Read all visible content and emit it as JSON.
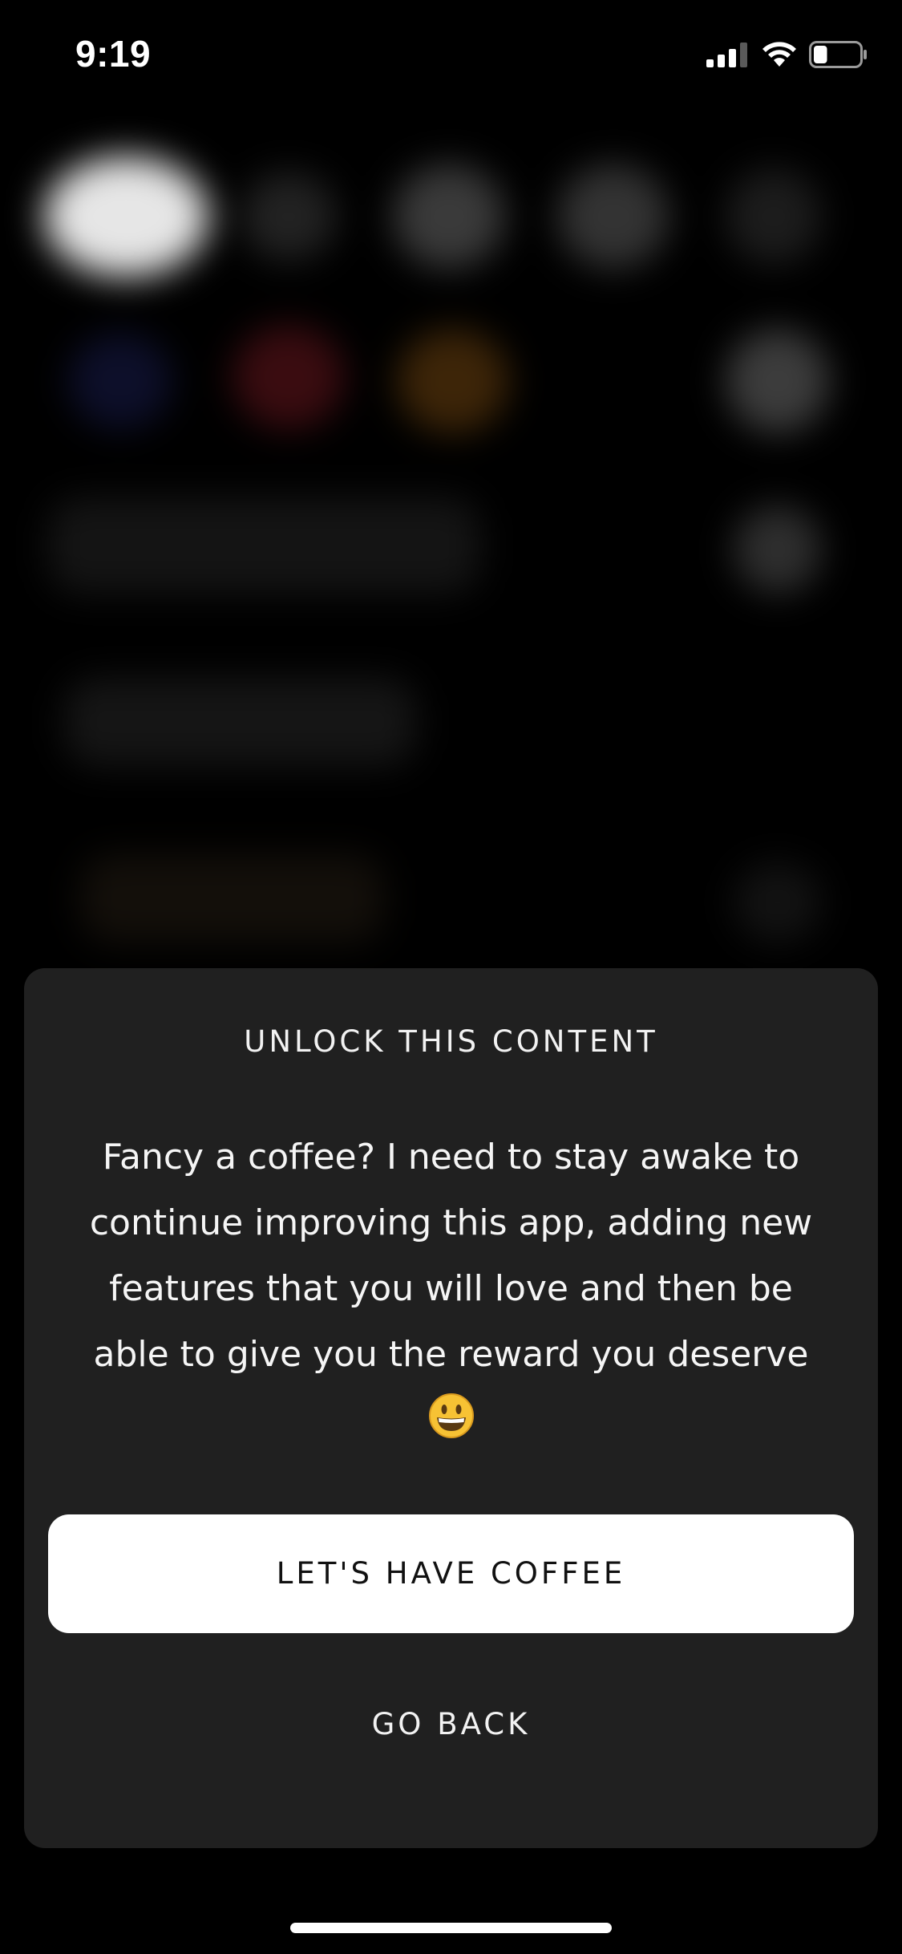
{
  "status_bar": {
    "time": "9:19",
    "icons": [
      "cellular-signal-icon",
      "wifi-icon",
      "battery-icon"
    ],
    "battery_level": 0.3
  },
  "background": {
    "description_hidden": true
  },
  "sheet": {
    "title": "UNLOCK THIS CONTENT",
    "message": "Fancy a coffee? I need to stay awake to continue improving this app, adding new features that you will love and then be able to give you the reward you deserve",
    "emoji": "grinning-face-emoji",
    "primary_button_label": "LET'S HAVE COFFEE",
    "secondary_button_label": "GO BACK"
  },
  "colors": {
    "sheet_background": "#202020",
    "primary_button": "#ffffff",
    "emoji_yellow": "#f7c234"
  }
}
